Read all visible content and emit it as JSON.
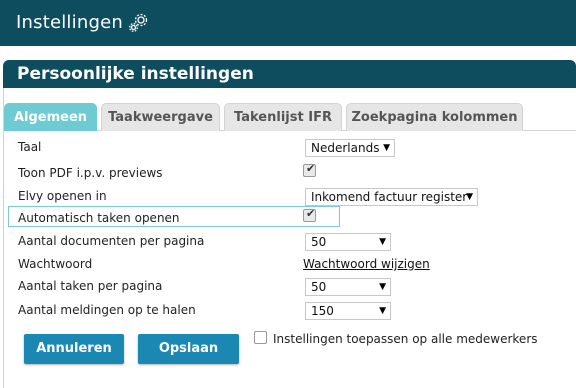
{
  "app": {
    "title": "Instellingen"
  },
  "panel": {
    "title": "Persoonlijke instellingen"
  },
  "tabs": [
    {
      "label": "Algemeen",
      "active": true
    },
    {
      "label": "Taakweergave",
      "active": false
    },
    {
      "label": "Takenlijst IFR",
      "active": false
    },
    {
      "label": "Zoekpagina kolommen",
      "active": false
    }
  ],
  "settings": {
    "taal": {
      "label": "Taal",
      "value": "Nederlands"
    },
    "pdf": {
      "label": "Toon PDF i.p.v. previews",
      "checked": true
    },
    "elvy": {
      "label": "Elvy openen in",
      "value": "Inkomend factuur register"
    },
    "auto": {
      "label": "Automatisch taken openen",
      "checked": true
    },
    "docs": {
      "label": "Aantal documenten per pagina",
      "value": "50"
    },
    "password": {
      "label": "Wachtwoord",
      "link": "Wachtwoord wijzigen"
    },
    "taken": {
      "label": "Aantal taken per pagina",
      "value": "50"
    },
    "meldingen": {
      "label": "Aantal meldingen op te halen",
      "value": "150"
    }
  },
  "actions": {
    "cancel": "Annuleren",
    "save": "Opslaan",
    "apply_all": {
      "label": "Instellingen toepassen op alle medewerkers",
      "checked": false
    }
  },
  "colors": {
    "header": "#0e4d5e",
    "active_tab": "#6ecbd1",
    "button": "#1b87b3"
  },
  "icons": {
    "settings": "gear-cog-icon"
  }
}
